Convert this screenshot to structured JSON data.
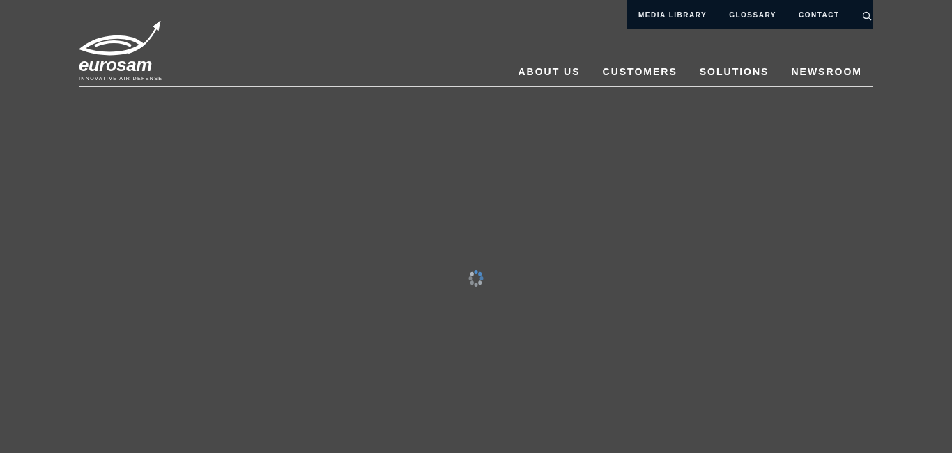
{
  "logo": {
    "wordmark": "eurosam",
    "tagline": "INNOVATIVE AIR DEFENSE"
  },
  "utility_nav": {
    "items": [
      "MEDIA LIBRARY",
      "GLOSSARY",
      "CONTACT"
    ]
  },
  "main_nav": {
    "items": [
      "ABOUT US",
      "CUSTOMERS",
      "SOLUTIONS",
      "NEWSROOM"
    ]
  }
}
